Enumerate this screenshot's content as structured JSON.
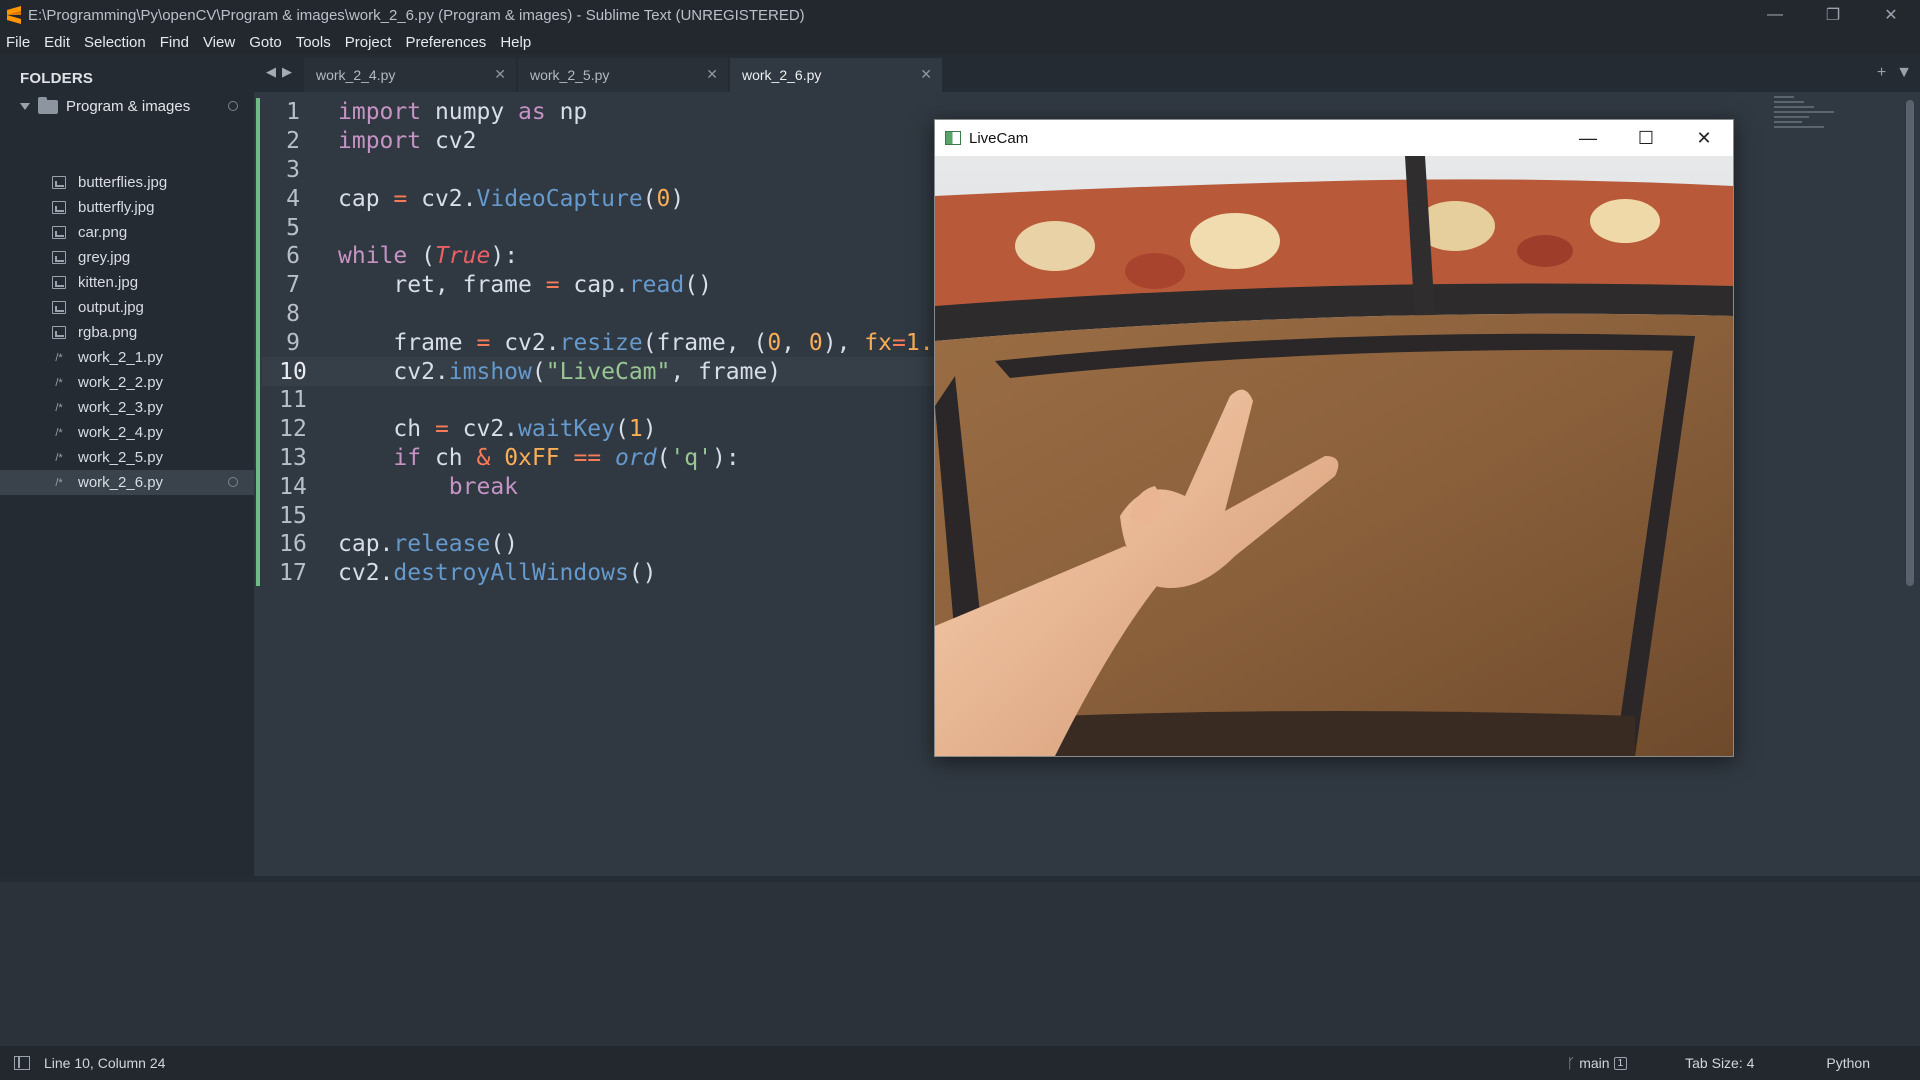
{
  "window": {
    "title": "E:\\Programming\\Py\\openCV\\Program & images\\work_2_6.py (Program & images) - Sublime Text (UNREGISTERED)",
    "minimize_glyph": "—",
    "restore_glyph": "❐",
    "close_glyph": "✕"
  },
  "menu": [
    "File",
    "Edit",
    "Selection",
    "Find",
    "View",
    "Goto",
    "Tools",
    "Project",
    "Preferences",
    "Help"
  ],
  "sidebar": {
    "heading": "FOLDERS",
    "root_folder": "Program & images",
    "files": [
      {
        "name": "butterflies.jpg",
        "icon": "image-file-icon"
      },
      {
        "name": "butterfly.jpg",
        "icon": "image-file-icon"
      },
      {
        "name": "car.png",
        "icon": "image-file-icon"
      },
      {
        "name": "grey.jpg",
        "icon": "image-file-icon"
      },
      {
        "name": "kitten.jpg",
        "icon": "image-file-icon"
      },
      {
        "name": "output.jpg",
        "icon": "image-file-icon"
      },
      {
        "name": "rgba.png",
        "icon": "image-file-icon"
      },
      {
        "name": "work_2_1.py",
        "icon": "code-file-icon"
      },
      {
        "name": "work_2_2.py",
        "icon": "code-file-icon"
      },
      {
        "name": "work_2_3.py",
        "icon": "code-file-icon"
      },
      {
        "name": "work_2_4.py",
        "icon": "code-file-icon"
      },
      {
        "name": "work_2_5.py",
        "icon": "code-file-icon"
      },
      {
        "name": "work_2_6.py",
        "icon": "code-file-icon",
        "active": true
      }
    ],
    "code_glyph": "/*"
  },
  "tabs": [
    {
      "label": "work_2_4.py",
      "active": false
    },
    {
      "label": "work_2_5.py",
      "active": false
    },
    {
      "label": "work_2_6.py",
      "active": true
    }
  ],
  "tab_close_glyph": "✕",
  "tab_nav": {
    "back": "◀",
    "forward": "▶",
    "add": "+",
    "menu": "▼"
  },
  "editor": {
    "current_line": 10,
    "line_numbers": [
      "1",
      "2",
      "3",
      "4",
      "5",
      "6",
      "7",
      "8",
      "9",
      "10",
      "11",
      "12",
      "13",
      "14",
      "15",
      "16",
      "17"
    ]
  },
  "livecam": {
    "title": "LiveCam",
    "minimize_glyph": "—",
    "maximize_glyph": "☐",
    "close_glyph": "✕"
  },
  "statusbar": {
    "position": "Line 10, Column 24",
    "branch": "main",
    "branch_badge": "1",
    "branch_glyph": "ᚴ",
    "tab_size": "Tab Size: 4",
    "syntax": "Python"
  },
  "colors": {
    "editor_bg": "#303841",
    "sidebar_bg": "#252b32",
    "keyword": "#c594c5",
    "function": "#6699cc",
    "number": "#f9ae58",
    "string": "#99c794",
    "operator": "#f97b58",
    "gutter_added": "#6dbb85"
  }
}
